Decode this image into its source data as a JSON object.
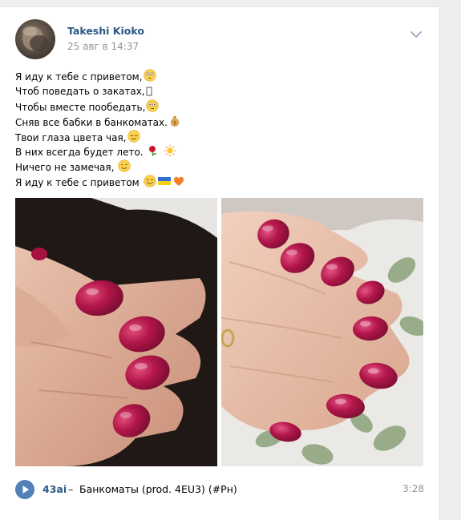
{
  "post": {
    "author": "Takeshi Kioko",
    "date": "25 авг в 14:37",
    "lines": [
      "Я иду к тебе с приветом,",
      "Чтоб поведать о закатах,",
      "Чтобы вместе пообедать,",
      "Сняв все бабки в банкоматах.",
      "Твои глаза цвета чая,",
      "В них всегда будет лето.",
      "Ничего не замечая,",
      "Я иду к тебе с приветом"
    ],
    "menu_icon": "chevron-down-icon"
  },
  "photos": [
    {
      "icon": "photo-nails-1"
    },
    {
      "icon": "photo-nails-2"
    }
  ],
  "audio": {
    "artist": "43ai",
    "separator": "–",
    "title": "Банкоматы (prod. 4EU3) (#Рн)",
    "duration": "3:28"
  },
  "colors": {
    "link": "#2a5885",
    "muted": "#939393",
    "play": "#5181b8",
    "nail": "#b3164a"
  }
}
